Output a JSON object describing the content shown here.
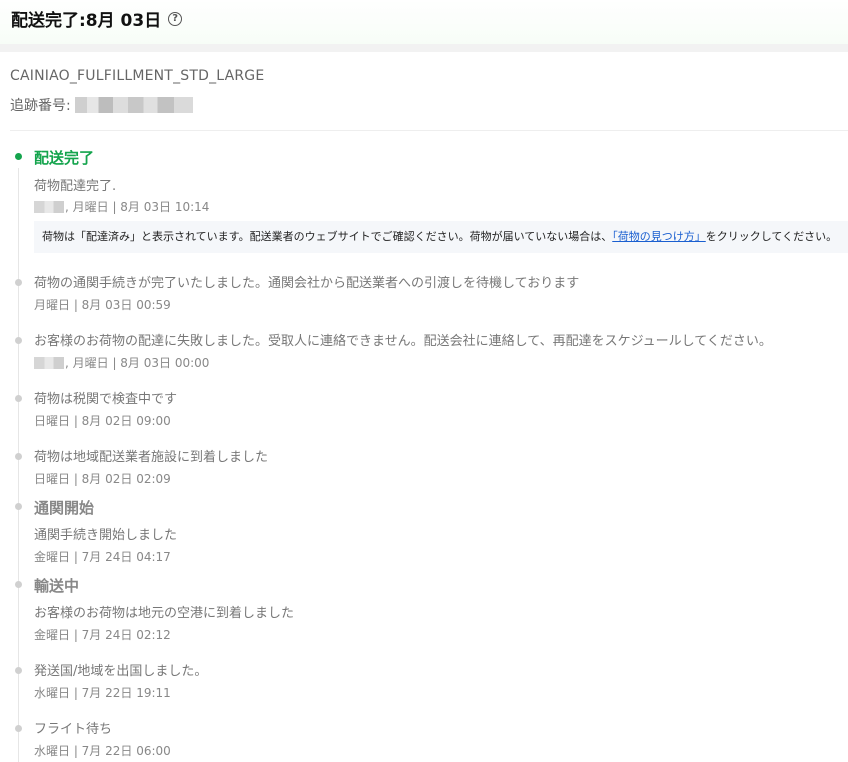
{
  "header": {
    "title": "配送完了:8月 03日",
    "help_icon": "?"
  },
  "shipment": {
    "carrier": "CAINIAO_FULFILLMENT_STD_LARGE",
    "tracking_label": "追跡番号:"
  },
  "notice": {
    "text_before": "荷物は「配達済み」と表示されています。配送業者のウェブサイトでご確認ください。荷物が届いていない場合は、",
    "link": "「荷物の見つけ方」",
    "text_after": "をクリックしてください。"
  },
  "events": [
    {
      "title": "配送完了",
      "desc": "荷物配達完了.",
      "time": ", 月曜日 | 8月 03日 10:14"
    },
    {
      "desc": "荷物の通関手続きが完了いたしました。通関会社から配送業者への引渡しを待機しております",
      "time": "月曜日 | 8月 03日 00:59"
    },
    {
      "desc": "お客様のお荷物の配達に失敗しました。受取人に連絡できません。配送会社に連絡して、再配達をスケジュールしてください。",
      "time": ", 月曜日 | 8月 03日 00:00"
    },
    {
      "desc": "荷物は税関で検査中です",
      "time": "日曜日 | 8月 02日 09:00"
    },
    {
      "desc": "荷物は地域配送業者施設に到着しました",
      "time": "日曜日 | 8月 02日 02:09"
    },
    {
      "title": "通関開始",
      "desc": "通関手続き開始しました",
      "time": "金曜日 | 7月 24日 04:17"
    },
    {
      "title": "輸送中",
      "desc": "お客様のお荷物は地元の空港に到着しました",
      "time": "金曜日 | 7月 24日 02:12"
    },
    {
      "desc": "発送国/地域を出国しました。",
      "time": "水曜日 | 7月 22日 19:11"
    },
    {
      "desc": "フライト待ち",
      "time": "水曜日 | 7月 22日 06:00"
    }
  ],
  "colors": {
    "active": "#14a44d",
    "link": "#1a5fd0"
  }
}
